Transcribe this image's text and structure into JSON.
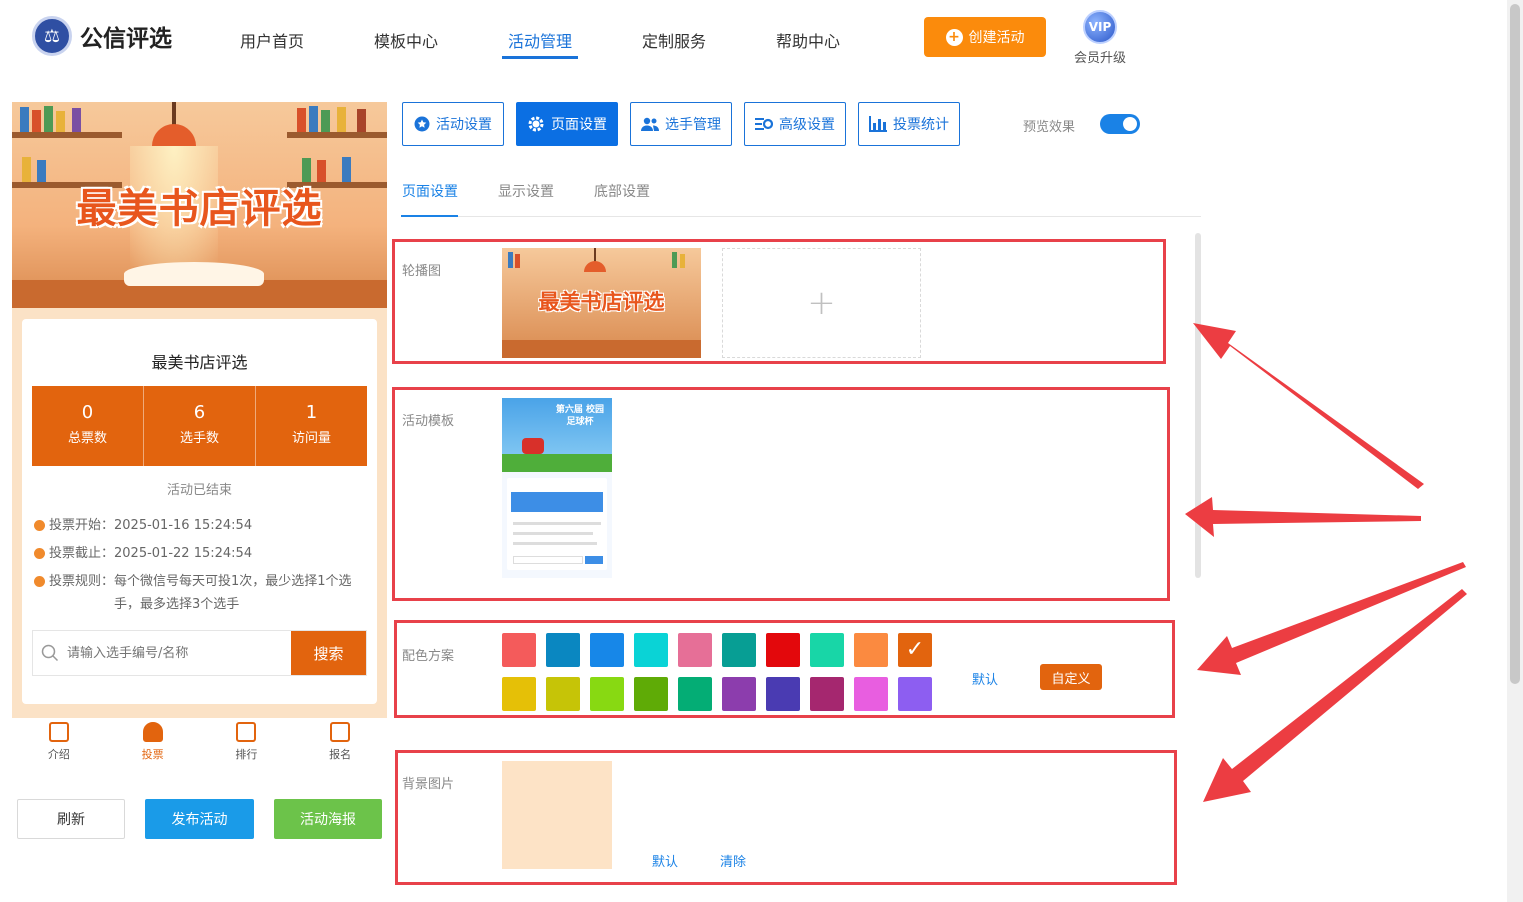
{
  "brand": {
    "name": "公信评选"
  },
  "nav": {
    "items": [
      {
        "label": "用户首页"
      },
      {
        "label": "模板中心"
      },
      {
        "label": "活动管理"
      },
      {
        "label": "定制服务"
      },
      {
        "label": "帮助中心"
      }
    ],
    "active": "活动管理",
    "create_button": "创建活动",
    "vip_badge": "VIP",
    "vip_label": "会员升级"
  },
  "preview": {
    "banner_title": "最美书店评选",
    "title": "最美书店评选",
    "stats": [
      {
        "value": "0",
        "label": "总票数"
      },
      {
        "value": "6",
        "label": "选手数"
      },
      {
        "value": "1",
        "label": "访问量"
      }
    ],
    "status": "活动已结束",
    "rules": [
      {
        "label": "投票开始：",
        "value": "2025-01-16 15:24:54"
      },
      {
        "label": "投票截止：",
        "value": "2025-01-22 15:24:54"
      },
      {
        "label": "投票规则：",
        "value": "每个微信号每天可投1次，最少选择1个选手，最多选择3个选手"
      }
    ],
    "search_placeholder": "请输入选手编号/名称",
    "search_button": "搜索",
    "tabbar": [
      {
        "label": "介绍"
      },
      {
        "label": "投票"
      },
      {
        "label": "排行"
      },
      {
        "label": "报名"
      }
    ],
    "active_tab": "投票"
  },
  "actions": {
    "refresh": "刷新",
    "publish": "发布活动",
    "poster": "活动海报"
  },
  "toolbar": {
    "buttons": [
      {
        "label": "活动设置",
        "icon": "star-icon"
      },
      {
        "label": "页面设置",
        "icon": "gear-icon"
      },
      {
        "label": "选手管理",
        "icon": "users-icon"
      },
      {
        "label": "高级设置",
        "icon": "settings-sliders-icon"
      },
      {
        "label": "投票统计",
        "icon": "bar-chart-icon"
      }
    ],
    "active": "页面设置",
    "preview_label": "预览效果",
    "preview_enabled": true
  },
  "subtabs": {
    "items": [
      {
        "label": "页面设置"
      },
      {
        "label": "显示设置"
      },
      {
        "label": "底部设置"
      }
    ],
    "active": "页面设置"
  },
  "sections": {
    "carousel": {
      "label": "轮播图",
      "image_title": "最美书店评选"
    },
    "template": {
      "label": "活动模板",
      "thumb_title": "第六届 校园足球杯"
    },
    "colors": {
      "label": "配色方案",
      "row1": [
        "#f45b5b",
        "#0a87c1",
        "#1787e8",
        "#0ad3d6",
        "#e66f97",
        "#079e94",
        "#e3080c",
        "#18d6a7",
        "#fb8a40",
        "#e2640e"
      ],
      "row2": [
        "#e5c007",
        "#c6c407",
        "#88d912",
        "#5fab06",
        "#04ad75",
        "#8c3dad",
        "#4a3bb2",
        "#a5276f",
        "#e85ee0",
        "#8d5ef1"
      ],
      "selected": "#e2640e",
      "default_link": "默认",
      "custom_button": "自定义"
    },
    "background": {
      "label": "背景图片",
      "default_link": "默认",
      "clear_link": "清除"
    }
  },
  "colors": {
    "primary": "#1a73d9",
    "accent": "#e2640e",
    "create": "#fb8b0c",
    "annotation": "#e8414a"
  }
}
